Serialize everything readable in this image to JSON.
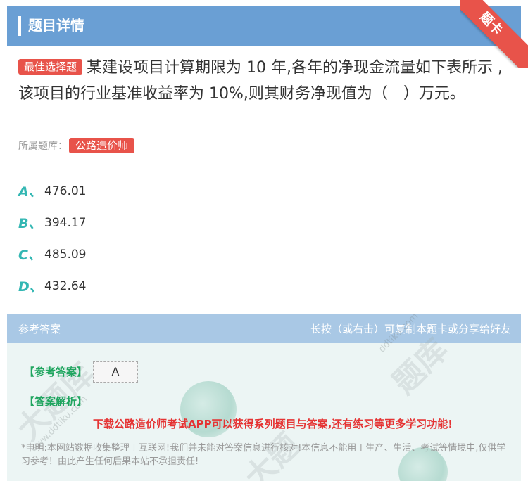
{
  "header": {
    "title": "题目详情"
  },
  "ribbon": {
    "label": "题卡"
  },
  "question": {
    "tag": "最佳选择题",
    "text": "某建设项目计算期限为 10 年,各年的净现金流量如下表所示 ,该项目的行业基准收益率为 10%,则其财务净现值为（　）万元。"
  },
  "source": {
    "label": "所属题库：",
    "tag": "公路造价师"
  },
  "options": [
    {
      "letter": "A、",
      "text": "476.01"
    },
    {
      "letter": "B、",
      "text": "394.17"
    },
    {
      "letter": "C、",
      "text": "485.09"
    },
    {
      "letter": "D、",
      "text": "432.64"
    }
  ],
  "answer_panel": {
    "head_left": "参考答案",
    "head_right": "长按（或右击）可复制本题卡或分享给好友",
    "answer_label": "【参考答案】",
    "answer_value": "A",
    "explain_label": "【答案解析】",
    "download_text": "下载公路造价师考试APP可以获得系列题目与答案,还有练习等更多学习功能!",
    "disclaimer": "*申明:本网站数据收集整理于互联网!我们并未能对答案信息进行核对!本信息不能用于生产、生活、考试等情境中,仅供学习参考！由此产生任何后果本站不承担责任!"
  },
  "colors": {
    "header": "#6a9fd4",
    "accent_red": "#e8534a",
    "option_letter": "#34b7b3",
    "answer_green": "#1fa55f"
  }
}
